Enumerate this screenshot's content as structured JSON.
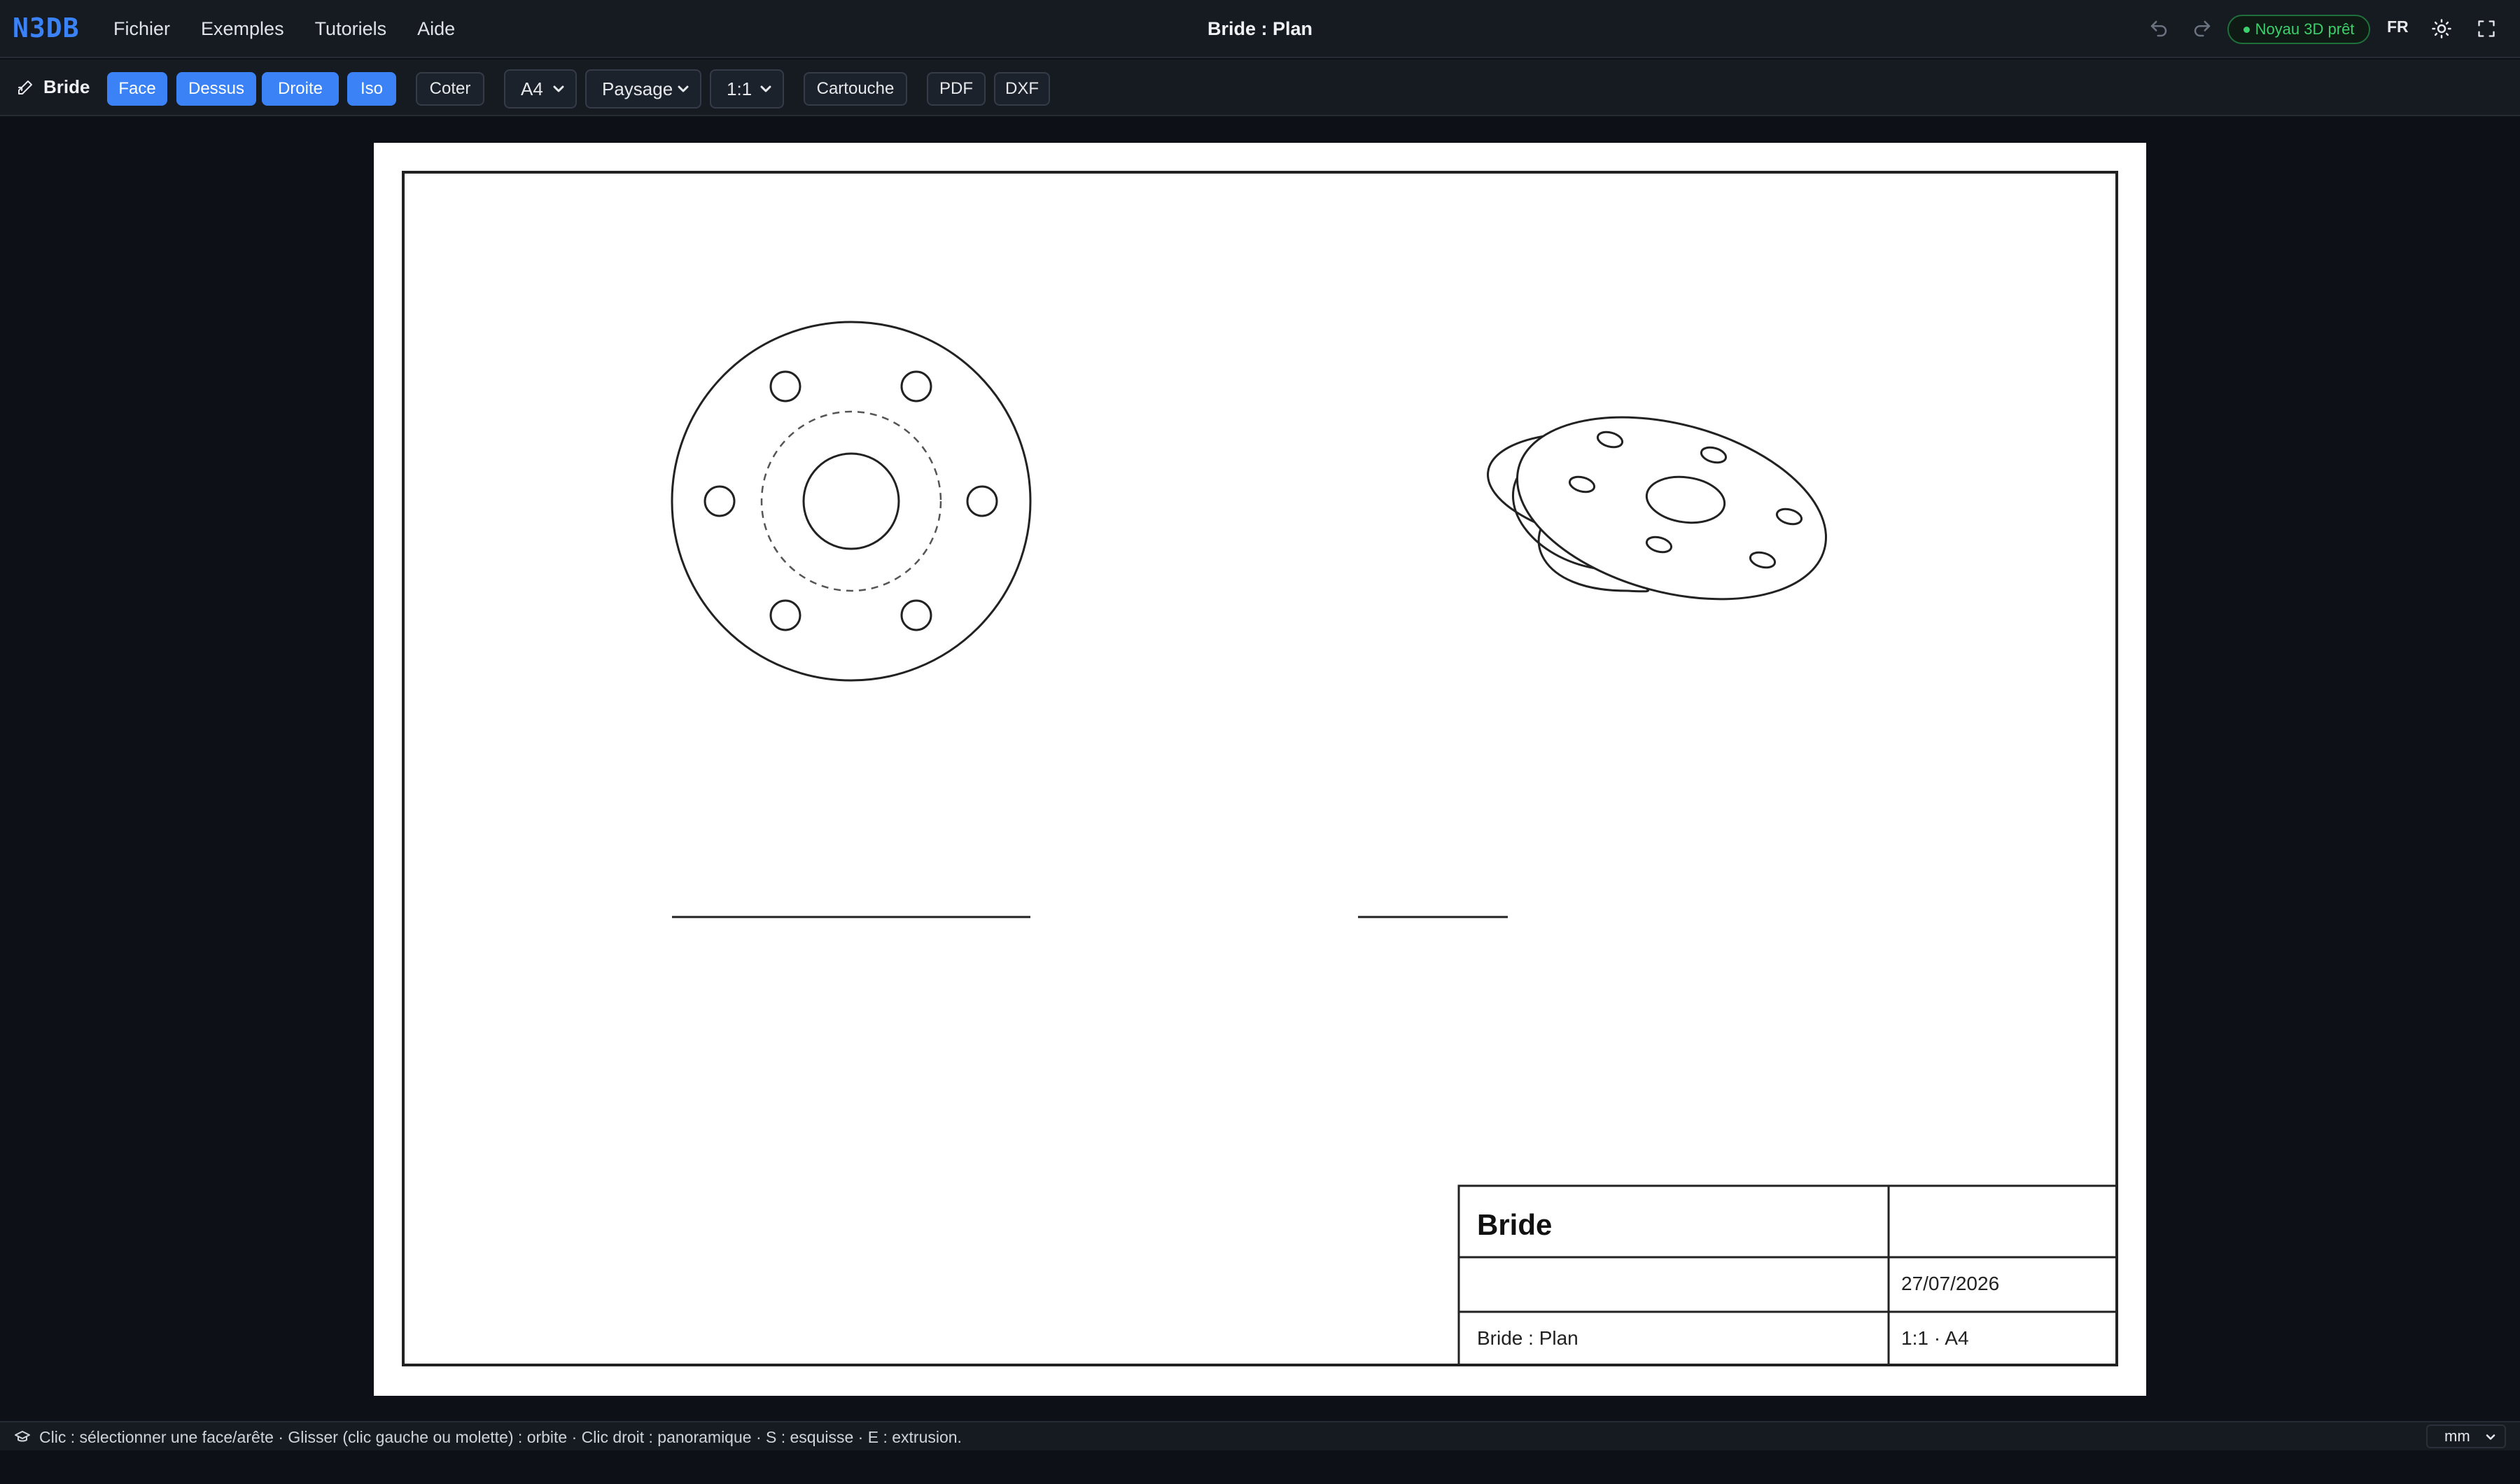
{
  "app": {
    "logo": "N3DB",
    "menu": [
      "Fichier",
      "Exemples",
      "Tutoriels",
      "Aide"
    ],
    "document_title": "Bride : Plan",
    "kernel_status": "Noyau 3D prêt",
    "language": "FR"
  },
  "toolbar": {
    "part_name": "Bride",
    "view_buttons": [
      {
        "label": "Face",
        "active": true
      },
      {
        "label": "Dessus",
        "active": true
      },
      {
        "label": "Droite",
        "active": true
      },
      {
        "label": "Iso",
        "active": true
      }
    ],
    "dimension_label": "Coter",
    "paper_size": "A4",
    "orientation": "Paysage",
    "scale": "1:1",
    "title_block_label": "Cartouche",
    "export_pdf": "PDF",
    "export_dxf": "DXF"
  },
  "drawing": {
    "title_block": {
      "part_title": "Bride",
      "top_right": "",
      "middle_left": "",
      "date": "27/07/2026",
      "drawing_name": "Bride : Plan",
      "scale_format": "1:1 · A4"
    }
  },
  "statusbar": {
    "hint": "Clic : sélectionner une face/arête · Glisser (clic gauche ou molette) : orbite · Clic droit : panoramique · S : esquisse · E : extrusion.",
    "unit": "mm"
  },
  "icons": {
    "undo": "undo-icon",
    "redo": "redo-icon",
    "theme": "sun-icon",
    "fullscreen": "fullscreen-icon",
    "part": "sketch-pencil-icon",
    "status": "graduation-cap-icon"
  },
  "colors": {
    "accent": "#3b82f6",
    "kernel_ok": "#3ccf6b",
    "background": "#0d1117",
    "panel": "#161b22"
  }
}
